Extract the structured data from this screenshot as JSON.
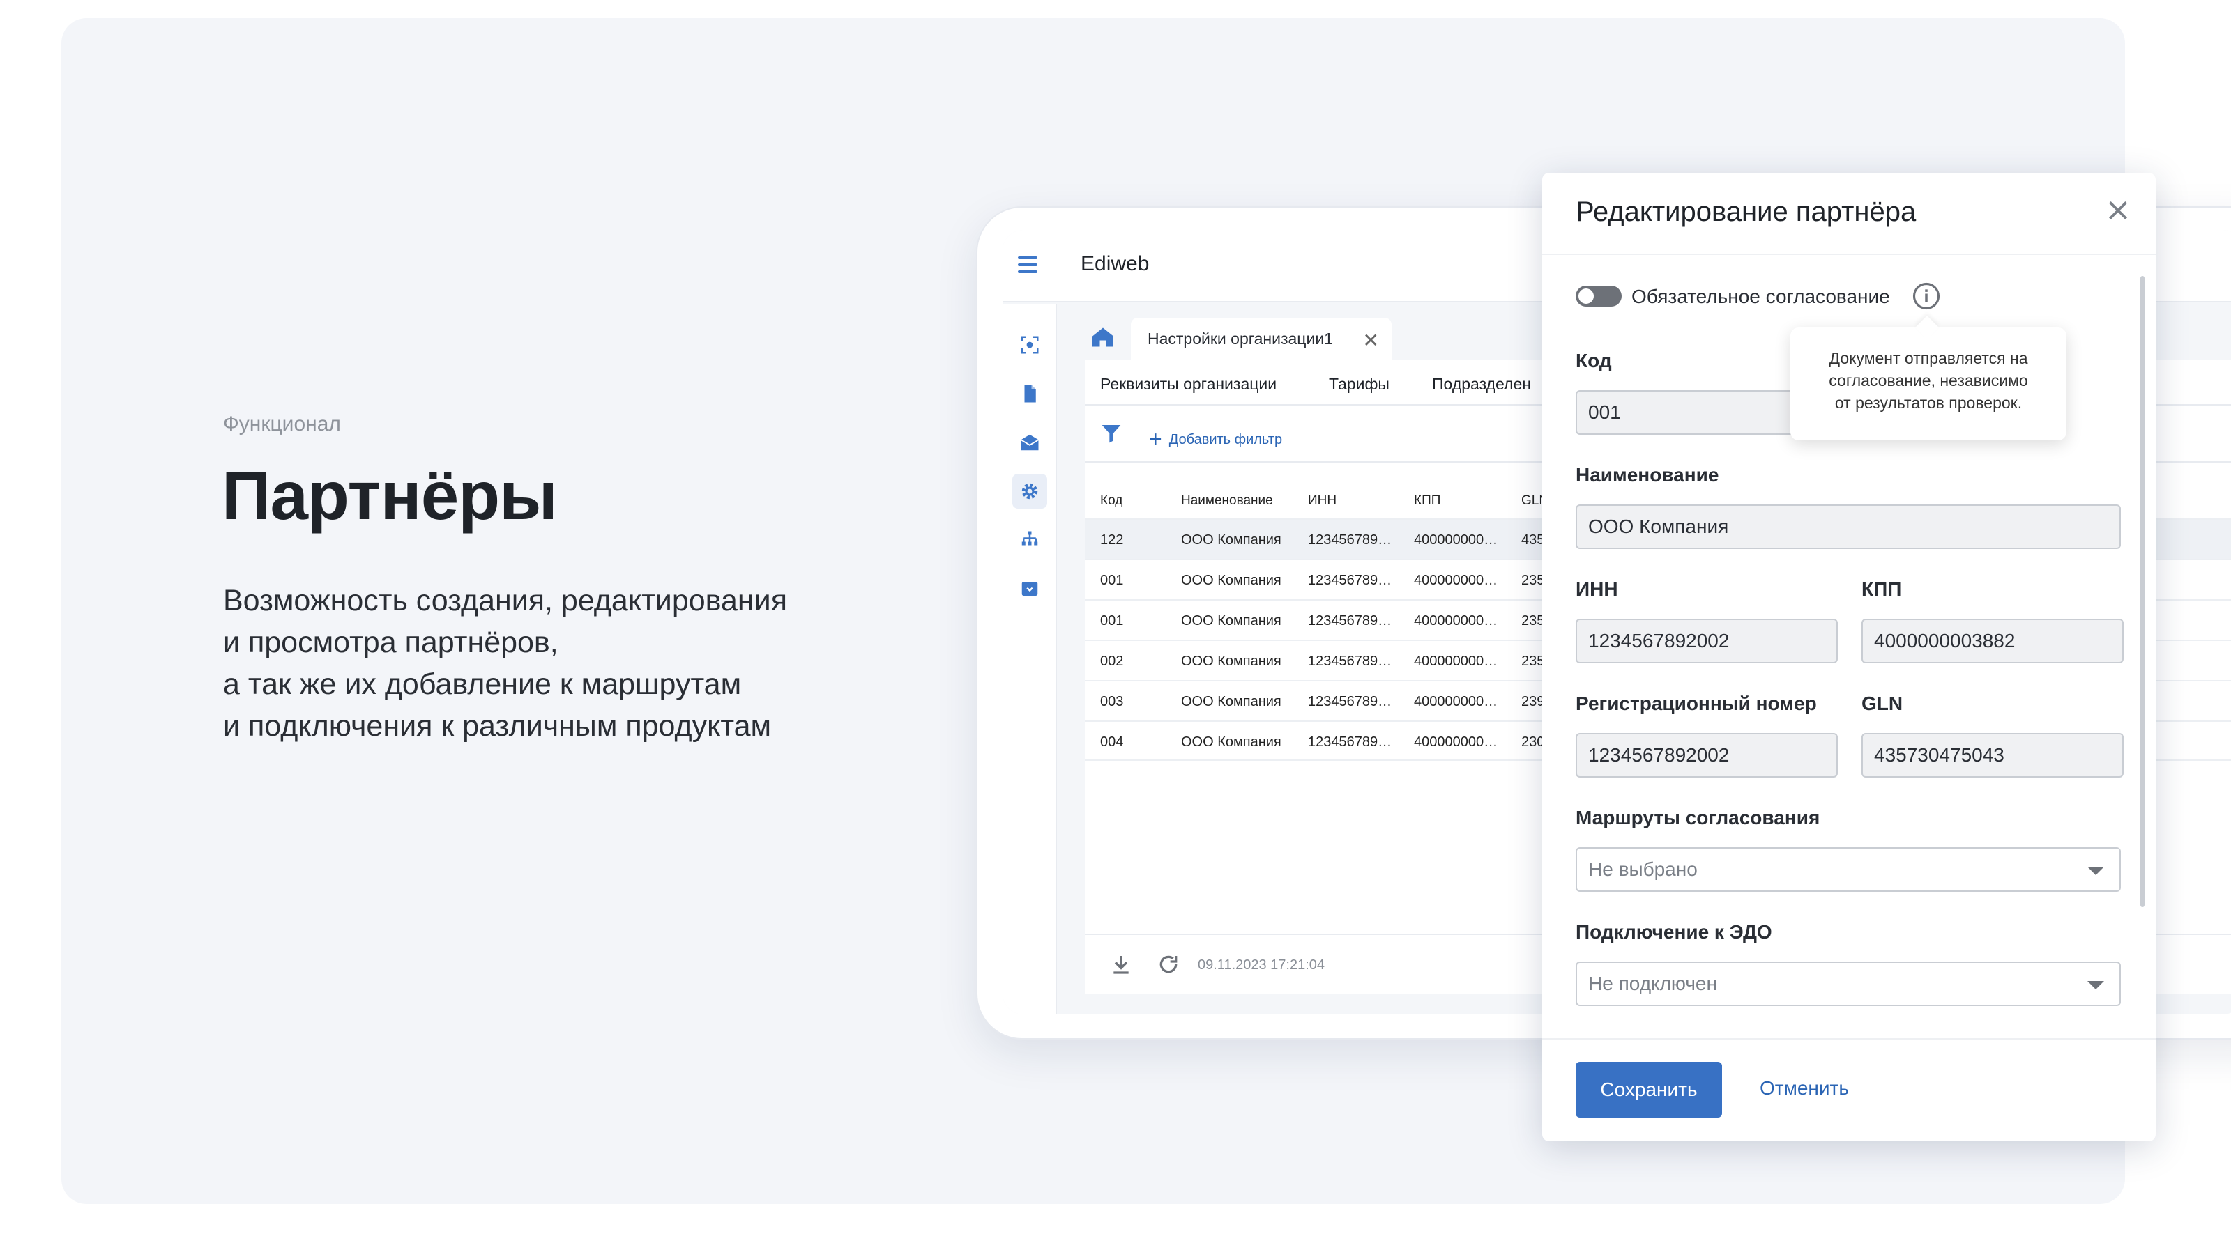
{
  "left": {
    "eyebrow": "Функционал",
    "headline": "Партнёры",
    "description": [
      "Возможность создания, редактирования",
      "и просмотра партнёров,",
      "а так же их добавление к маршрутам",
      "и подключения к различным продуктам"
    ]
  },
  "app": {
    "brand": "Ediweb",
    "sidebar_icons": [
      "scan-icon",
      "document-icon",
      "mail-icon",
      "gear-icon",
      "hierarchy-icon",
      "archive-icon"
    ],
    "tab_label": "Настройки организации1",
    "subtabs": [
      "Реквизиты организации",
      "Тарифы",
      "Подразделен"
    ],
    "add_filter_label": "Добавить фильтр",
    "table": {
      "headers": [
        "Код",
        "Наименование",
        "ИНН",
        "КПП",
        "GLN"
      ],
      "rows": [
        [
          "122",
          "ООО Компания",
          "123456789…",
          "400000000…",
          "435"
        ],
        [
          "001",
          "ООО Компания",
          "123456789…",
          "400000000…",
          "235"
        ],
        [
          "001",
          "ООО Компания",
          "123456789…",
          "400000000…",
          "235"
        ],
        [
          "002",
          "ООО Компания",
          "123456789…",
          "400000000…",
          "235"
        ],
        [
          "003",
          "ООО Компания",
          "123456789…",
          "400000000…",
          "239"
        ],
        [
          "004",
          "ООО Компания",
          "123456789…",
          "400000000…",
          "230"
        ]
      ]
    },
    "footer_timestamp": "09.11.2023 17:21:04"
  },
  "modal": {
    "title": "Редактирование партнёра",
    "toggle_label": "Обязательное согласование",
    "toggle_on": false,
    "tooltip": [
      "Документ отправляется на",
      "согласование, независимо",
      "от результатов проверок."
    ],
    "fields": {
      "code": {
        "label": "Код",
        "value": "001"
      },
      "name": {
        "label": "Наименование",
        "value": "ООО Компания"
      },
      "inn": {
        "label": "ИНН",
        "value": "1234567892002"
      },
      "kpp": {
        "label": "КПП",
        "value": "4000000003882"
      },
      "reg": {
        "label": "Регистрационный номер",
        "value": "1234567892002"
      },
      "gln": {
        "label": "GLN",
        "value": "435730475043"
      },
      "routes": {
        "label": "Маршруты согласования",
        "value": "Не выбрано"
      },
      "edo": {
        "label": "Подключение к ЭДО",
        "value": "Не подключен"
      }
    },
    "save_label": "Сохранить",
    "cancel_label": "Отменить"
  },
  "colors": {
    "accent": "#3871c4",
    "panel_bg": "#f3f5f9",
    "text_dark": "#1f2329"
  }
}
